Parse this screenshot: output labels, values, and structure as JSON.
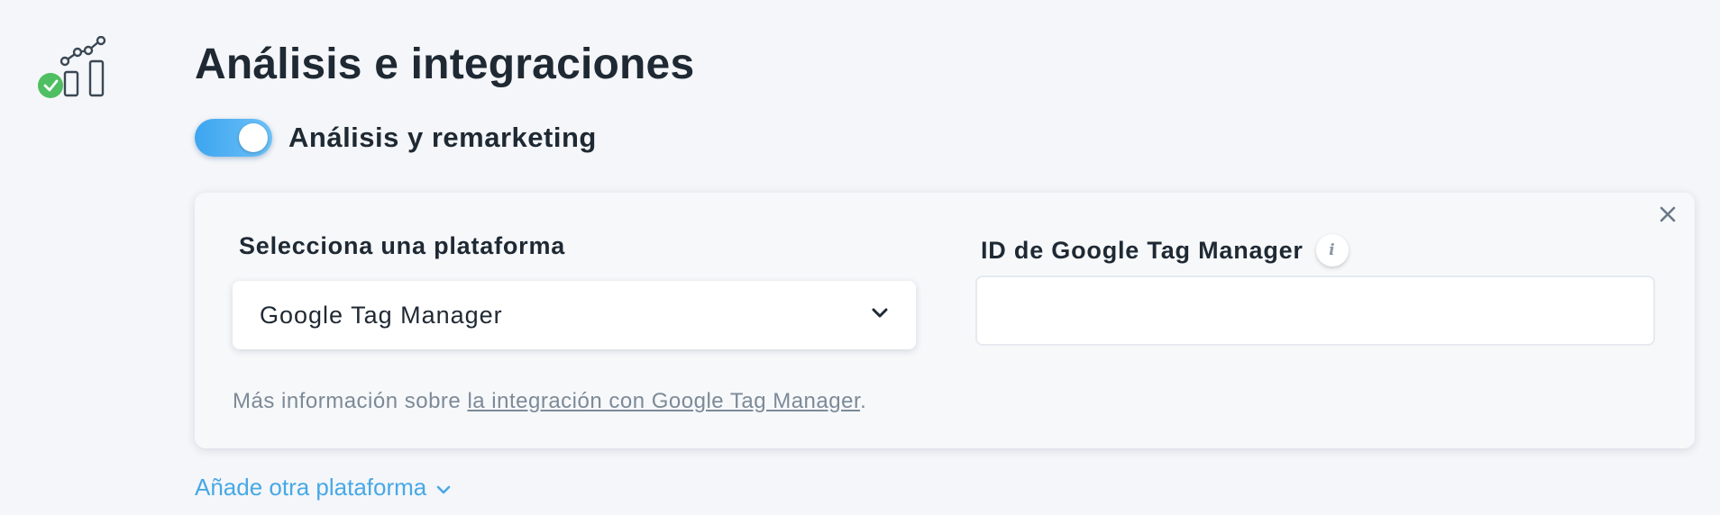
{
  "section": {
    "icon": "analytics-chart-icon",
    "status_icon": "check-circle-icon",
    "title": "Análisis e integraciones"
  },
  "toggle": {
    "label": "Análisis y remarketing",
    "enabled": true,
    "accent_color": "#3da5f0"
  },
  "integration_card": {
    "platform_label": "Selecciona una plataforma",
    "platform_selected": "Google Tag Manager",
    "id_label": "ID de Google Tag Manager",
    "id_value": "",
    "id_placeholder": "",
    "help_prefix": "Más información sobre ",
    "help_link": "la integración con Google Tag Manager",
    "help_suffix": ".",
    "info_glyph": "i",
    "close_icon": "close-icon"
  },
  "add_platform": {
    "label": "Añade otra plataforma",
    "icon": "chevron-down-icon"
  }
}
